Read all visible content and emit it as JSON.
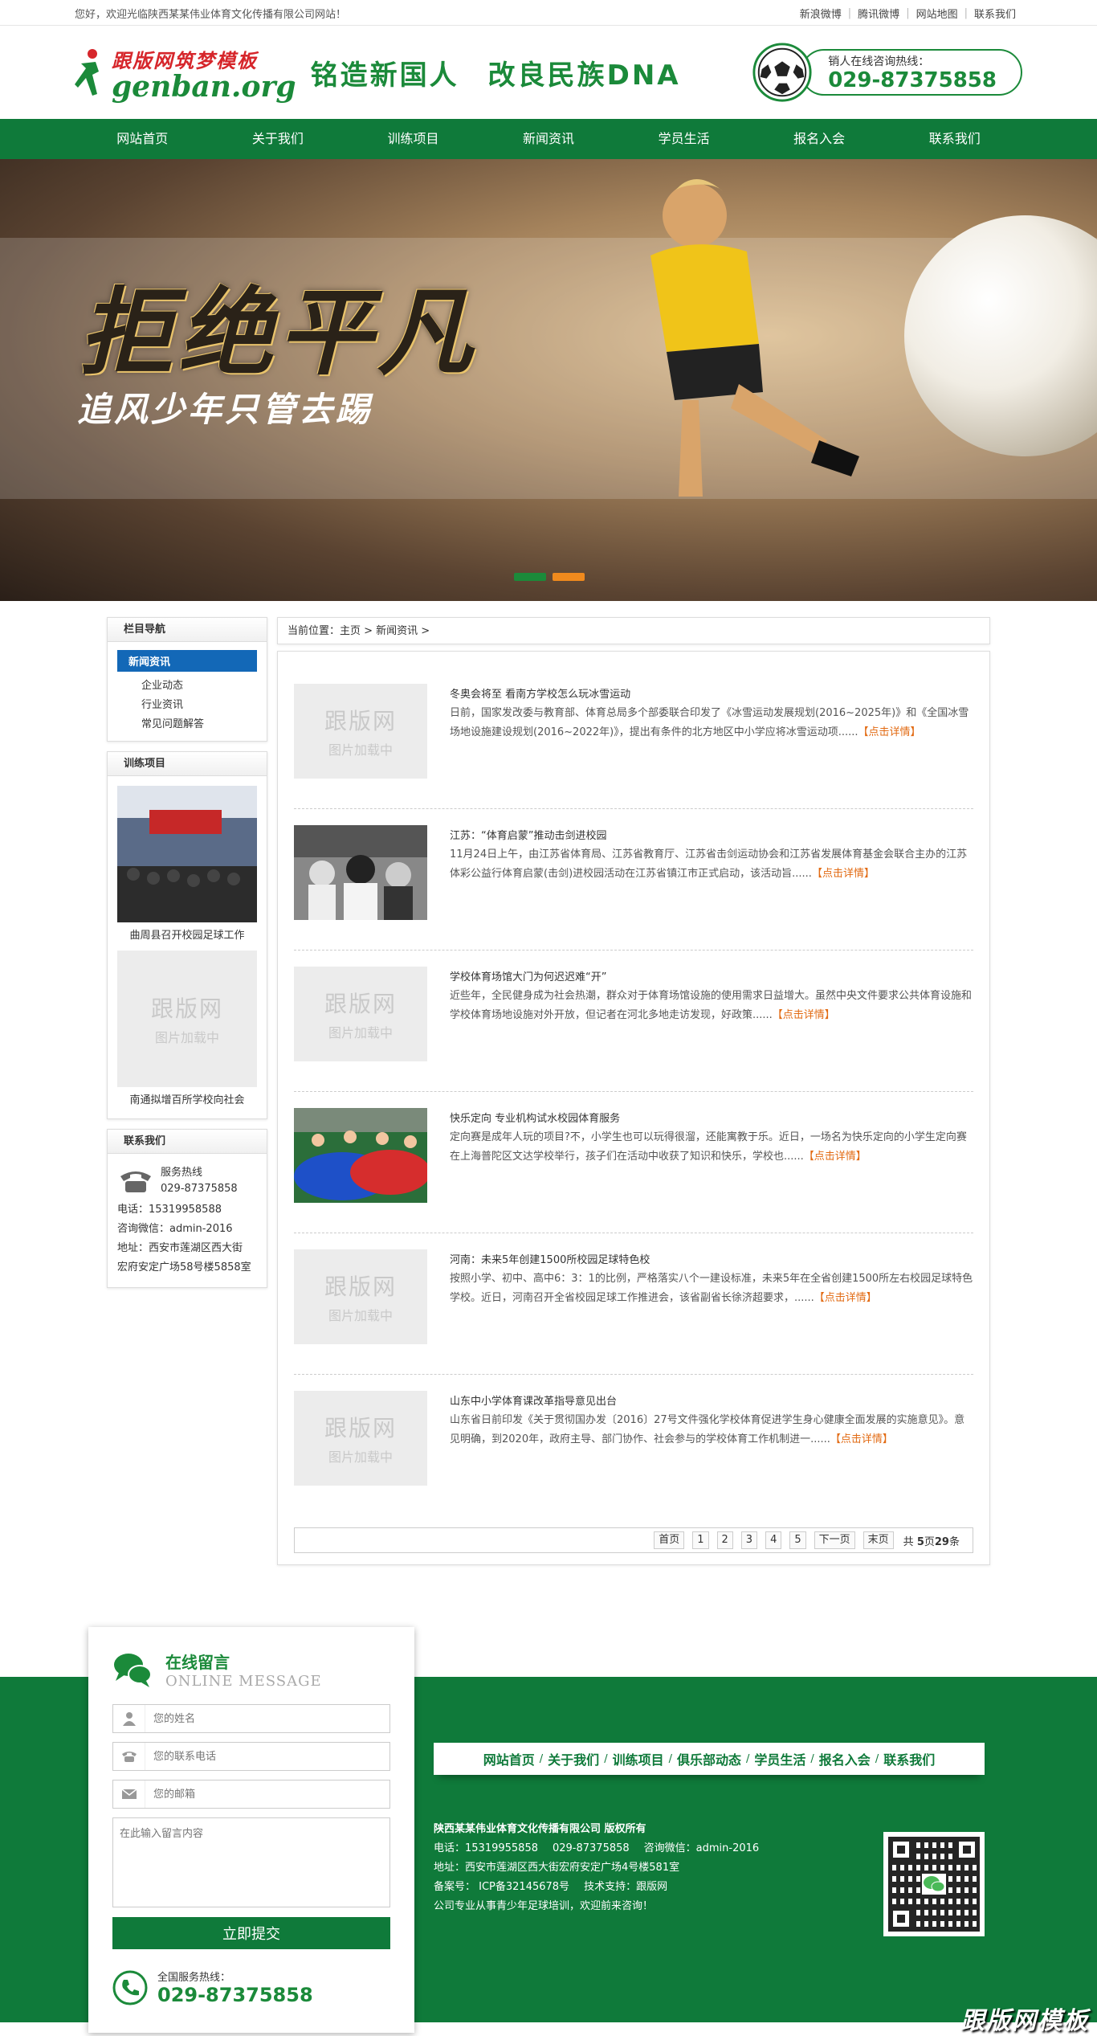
{
  "topbar": {
    "welcome": "您好，欢迎光临陕西某某伟业体育文化传播有限公司网站！",
    "links": [
      "新浪微博",
      "腾讯微博",
      "网站地图",
      "联系我们"
    ]
  },
  "header": {
    "logo_top": "跟版网筑梦模板",
    "logo_bottom": "genban.org",
    "slogan_1": "铭造新国人",
    "slogan_2": "改良民族DNA",
    "hotline_label": "销人在线咨询热线：",
    "hotline_number": "029-87375858"
  },
  "nav": [
    "网站首页",
    "关于我们",
    "训练项目",
    "新闻资讯",
    "学员生活",
    "报名入会",
    "联系我们"
  ],
  "banner": {
    "headline": "拒绝平凡",
    "subline": "追风少年只管去踢",
    "dot_colors": [
      "#1b8a3a",
      "#f08a1d"
    ]
  },
  "sidebar": {
    "nav_title": "栏目导航",
    "nav_active": "新闻资讯",
    "nav_items": [
      "企业动态",
      "行业资讯",
      "常见问题解答"
    ],
    "train_title": "训练项目",
    "train_items": [
      "曲周县召开校园足球工作",
      "南通拟增百所学校向社会"
    ],
    "contact_title": "联系我们",
    "contact_hotline_label": "服务热线",
    "contact_hotline": "029-87375858",
    "contact_lines": [
      "电话：15319958588",
      "咨询微信：admin-2016",
      "地址：西安市莲湖区西大街",
      "宏府安定广场58号楼5858室"
    ]
  },
  "placeholder": {
    "line1": "跟版网",
    "line2": "图片加载中"
  },
  "breadcrumb": "当前位置：主页 > 新闻资讯 >",
  "news": [
    {
      "title": "冬奥会将至 看南方学校怎么玩冰雪运动",
      "summary": "日前，国家发改委与教育部、体育总局多个部委联合印发了《冰雪运动发展规划(2016~2025年)》和《全国冰雪场地设施建设规划(2016~2022年)》，提出有条件的北方地区中小学应将冰雪运动项......",
      "more": "【点击详情】",
      "thumb": "placeholder"
    },
    {
      "title": "江苏：“体育启蒙”推动击剑进校园",
      "summary": "11月24日上午，由江苏省体育局、江苏省教育厅、江苏省击剑运动协会和江苏省发展体育基金会联合主办的江苏体彩公益行体育启蒙(击剑)进校园活动在江苏省镇江市正式启动，该活动旨......",
      "more": "【点击详情】",
      "thumb": "photo-fencing"
    },
    {
      "title": "学校体育场馆大门为何迟迟难“开”",
      "summary": "近些年，全民健身成为社会热潮，群众对于体育场馆设施的使用需求日益增大。虽然中央文件要求公共体育设施和学校体育场地设施对外开放，但记者在河北多地走访发现，好政策......",
      "more": "【点击详情】",
      "thumb": "placeholder"
    },
    {
      "title": "快乐定向 专业机构试水校园体育服务",
      "summary": "定向赛是成年人玩的项目?不，小学生也可以玩得很溜，还能寓教于乐。近日，一场名为快乐定向的小学生定向赛在上海普陀区文达学校举行，孩子们在活动中收获了知识和快乐，学校也......",
      "more": "【点击详情】",
      "thumb": "photo-kids"
    },
    {
      "title": "河南：未来5年创建1500所校园足球特色校",
      "summary": "按照小学、初中、高中6：3：1的比例，严格落实八个一建设标准，未来5年在全省创建1500所左右校园足球特色学校。近日，河南召开全省校园足球工作推进会，该省副省长徐济超要求，......",
      "more": "【点击详情】",
      "thumb": "placeholder"
    },
    {
      "title": "山东中小学体育课改革指导意见出台",
      "summary": "山东省日前印发《关于贯彻国办发〔2016〕27号文件强化学校体育促进学生身心健康全面发展的实施意见》。意见明确，到2020年，政府主导、部门协作、社会参与的学校体育工作机制进一......",
      "more": "【点击详情】",
      "thumb": "placeholder"
    }
  ],
  "pager": {
    "first": "首页",
    "pages": [
      "1",
      "2",
      "3",
      "4",
      "5"
    ],
    "next": "下一页",
    "last": "末页",
    "total_prefix": "共",
    "total_pages": "5",
    "total_mid": "页",
    "total_items": "29",
    "total_suffix": "条"
  },
  "message": {
    "title": "在线留言",
    "subtitle": "ONLINE MESSAGE",
    "name_placeholder": "您的姓名",
    "phone_placeholder": "您的联系电话",
    "email_placeholder": "您的邮箱",
    "content_placeholder": "在此输入留言内容",
    "submit": "立即提交",
    "hotline_label": "全国服务热线：",
    "hotline": "029-87375858"
  },
  "footer": {
    "nav": [
      "网站首页",
      "关于我们",
      "训练项目",
      "俱乐部动态",
      "学员生活",
      "报名入会",
      "联系我们"
    ],
    "company": "陕西某某伟业体育文化传播有限公司 版权所有",
    "tel": "电话：15319955858",
    "phone": "029-87375858",
    "wechat": "咨询微信：admin-2016",
    "address": "地址：西安市莲湖区西大街宏府安定广场4号楼581室",
    "icp": "备案号： ICP备32145678号",
    "support": "技术支持：跟版网",
    "tagline": "公司专业从事青少年足球培训，欢迎前来咨询！",
    "watermark": "跟版网模板"
  },
  "colors": {
    "brand_green": "#0f7a3a",
    "accent_orange": "#e26a12",
    "active_blue": "#1368b7"
  }
}
